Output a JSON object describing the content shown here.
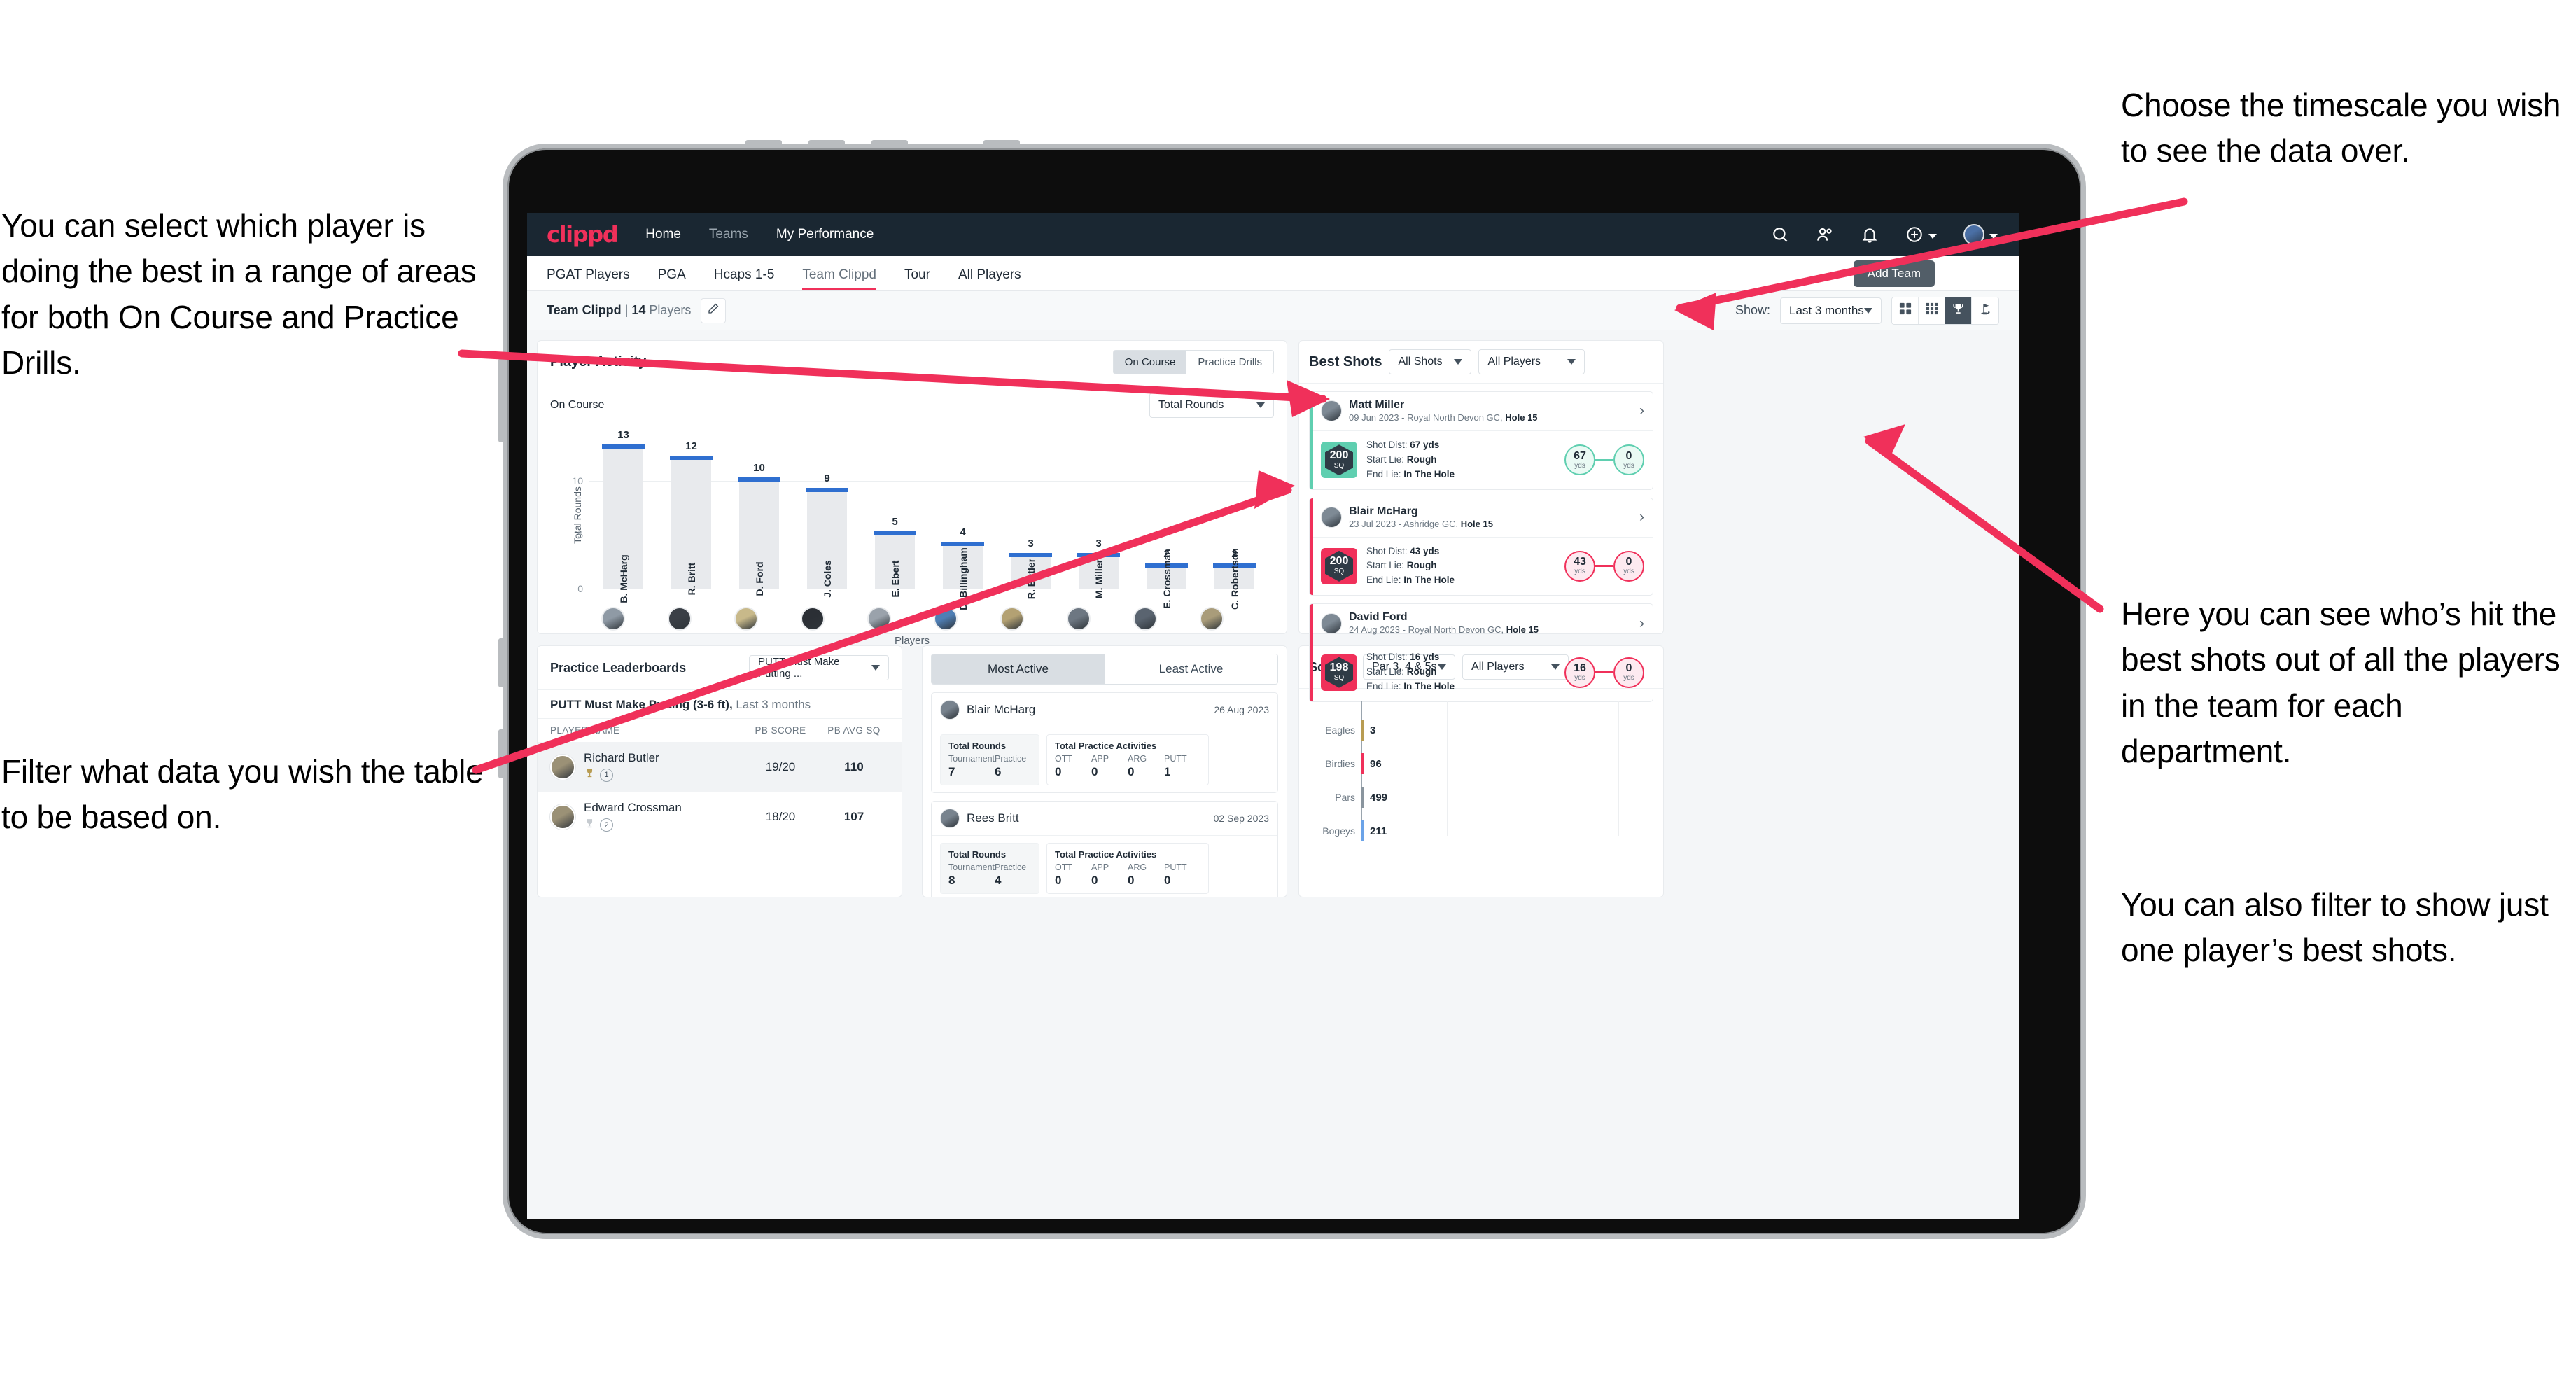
{
  "annotations": {
    "left_top": "You can select which player is doing the best in a range of areas for both On Course and Practice Drills.",
    "left_bottom": "Filter what data you wish the table to be based on.",
    "right_top": "Choose the timescale you wish to see the data over.",
    "right_middle": "Here you can see who’s hit the best shots out of all the players in the team for each department.",
    "right_bottom": "You can also filter to show just one player’s best shots."
  },
  "colors": {
    "brand_pink": "#f0305a",
    "nav_dark": "#1a2732",
    "bar_blue": "#2f6fd0",
    "teal": "#5fcfb0",
    "gold": "#b89c52"
  },
  "topnav": {
    "logo": "clippd",
    "links": [
      {
        "label": "Home",
        "dim": false
      },
      {
        "label": "Teams",
        "dim": true
      },
      {
        "label": "My Performance",
        "dim": false
      }
    ],
    "icons": [
      "search-icon",
      "people-icon",
      "bell-icon",
      "plus-circle-icon",
      "avatar-icon"
    ]
  },
  "tabs": {
    "items": [
      "PGAT Players",
      "PGA",
      "Hcaps 1-5",
      "Team Clippd",
      "Tour",
      "All Players"
    ],
    "active_index": 3,
    "tooltip": "Add Team"
  },
  "subheader": {
    "team_name": "Team Clippd",
    "separator": " | ",
    "player_count": "14",
    "players_word": " Players",
    "edit_icon": "pencil-icon",
    "show_label": "Show:",
    "timescale_value": "Last 3 months",
    "view_toggles": [
      {
        "icon": "grid-4-icon",
        "active": false
      },
      {
        "icon": "grid-9-icon",
        "active": false
      },
      {
        "icon": "trophy-icon",
        "active": true
      },
      {
        "icon": "golf-flag-icon",
        "active": false
      }
    ]
  },
  "player_activity": {
    "title": "Player Activity",
    "segments": [
      "On Course",
      "Practice Drills"
    ],
    "segment_active": 0,
    "sub_title": "On Course",
    "metric_select": "Total Rounds"
  },
  "chart_data": [
    {
      "type": "bar",
      "title": "Player Activity — On Course",
      "xlabel": "Players",
      "ylabel": "Total Rounds",
      "ylim": [
        0,
        14
      ],
      "yticks": [
        0,
        5,
        10
      ],
      "grid": true,
      "categories": [
        "B. McHarg",
        "R. Britt",
        "D. Ford",
        "J. Coles",
        "E. Ebert",
        "D. Billingham",
        "R. Butler",
        "M. Miller",
        "E. Crossman",
        "C. Robertson"
      ],
      "values": [
        13,
        12,
        10,
        9,
        5,
        4,
        3,
        3,
        2,
        2
      ]
    },
    {
      "type": "bar",
      "orientation": "horizontal",
      "title": "Scoring",
      "categories": [
        "Eagles",
        "Birdies",
        "Pars",
        "Bogeys"
      ],
      "values": [
        3,
        96,
        499,
        211
      ],
      "xlim": [
        0,
        560
      ],
      "colors": [
        "#b89c52",
        "#f0305a",
        "#8a959e",
        "#6ba3e8"
      ],
      "grid": true
    }
  ],
  "best_shots": {
    "title": "Best Shots",
    "filter_shots": "All Shots",
    "filter_players": "All Players",
    "cards": [
      {
        "player": "Matt Miller",
        "meta_date": "09 Jun 2023 - Royal North Devon GC, ",
        "meta_hole": "Hole 15",
        "badge_value": "200",
        "badge_unit": "SQ",
        "accent": "#5fcfb0",
        "shot_dist_label": "Shot Dist: ",
        "shot_dist": "67 yds",
        "start_lie_label": "Start Lie: ",
        "start_lie": "Rough",
        "end_lie_label": "End Lie: ",
        "end_lie": "In The Hole",
        "from_value": "67",
        "from_unit": "yds",
        "to_value": "0",
        "to_unit": "yds"
      },
      {
        "player": "Blair McHarg",
        "meta_date": "23 Jul 2023 - Ashridge GC, ",
        "meta_hole": "Hole 15",
        "badge_value": "200",
        "badge_unit": "SQ",
        "accent": "#f0305a",
        "shot_dist_label": "Shot Dist: ",
        "shot_dist": "43 yds",
        "start_lie_label": "Start Lie: ",
        "start_lie": "Rough",
        "end_lie_label": "End Lie: ",
        "end_lie": "In The Hole",
        "from_value": "43",
        "from_unit": "yds",
        "to_value": "0",
        "to_unit": "yds"
      },
      {
        "player": "David Ford",
        "meta_date": "24 Aug 2023 - Royal North Devon GC, ",
        "meta_hole": "Hole 15",
        "badge_value": "198",
        "badge_unit": "SQ",
        "accent": "#f0305a",
        "shot_dist_label": "Shot Dist: ",
        "shot_dist": "16 yds",
        "start_lie_label": "Start Lie: ",
        "start_lie": "Rough",
        "end_lie_label": "End Lie: ",
        "end_lie": "In The Hole",
        "from_value": "16",
        "from_unit": "yds",
        "to_value": "0",
        "to_unit": "yds"
      }
    ]
  },
  "practice_leaderboards": {
    "title": "Practice Leaderboards",
    "drill_select": "PUTT Must Make Putting ...",
    "subtitle_bold": "PUTT Must Make Putting (3-6 ft),",
    "subtitle_light": " Last 3 months",
    "columns": [
      "PLAYER NAME",
      "PB SCORE",
      "PB AVG SQ"
    ],
    "rows": [
      {
        "name": "Richard Butler",
        "rank": "1",
        "trophy": "gold",
        "pb_score": "19/20",
        "pb_avg_sq": "110",
        "highlight": true
      },
      {
        "name": "Edward Crossman",
        "rank": "2",
        "trophy": "silver",
        "pb_score": "18/20",
        "pb_avg_sq": "107",
        "highlight": false
      }
    ]
  },
  "activity": {
    "tabs": [
      "Most Active",
      "Least Active"
    ],
    "active_index": 0,
    "cards": [
      {
        "player": "Blair McHarg",
        "date": "26 Aug 2023",
        "rounds_title": "Total Rounds",
        "rounds_keys": [
          "Tournament",
          "Practice"
        ],
        "rounds_values": [
          "7",
          "6"
        ],
        "practice_title": "Total Practice Activities",
        "practice_keys": [
          "OTT",
          "APP",
          "ARG",
          "PUTT"
        ],
        "practice_values": [
          "0",
          "0",
          "0",
          "1"
        ]
      },
      {
        "player": "Rees Britt",
        "date": "02 Sep 2023",
        "rounds_title": "Total Rounds",
        "rounds_keys": [
          "Tournament",
          "Practice"
        ],
        "rounds_values": [
          "8",
          "4"
        ],
        "practice_title": "Total Practice Activities",
        "practice_keys": [
          "OTT",
          "APP",
          "ARG",
          "PUTT"
        ],
        "practice_values": [
          "0",
          "0",
          "0",
          "0"
        ]
      }
    ]
  },
  "scoring": {
    "title": "Scoring",
    "filter_par": "Par 3, 4 & 5s",
    "filter_players": "All Players"
  }
}
